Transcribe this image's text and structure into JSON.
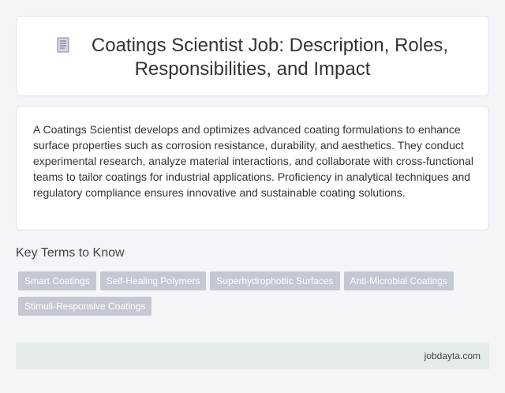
{
  "header": {
    "icon": "document-icon",
    "title": "Coatings Scientist Job: Description, Roles, Responsibilities, and Impact"
  },
  "description": "A Coatings Scientist develops and optimizes advanced coating formulations to enhance surface properties such as corrosion resistance, durability, and aesthetics. They conduct experimental research, analyze material interactions, and collaborate with cross-functional teams to tailor coatings for industrial applications. Proficiency in analytical techniques and regulatory compliance ensures innovative and sustainable coating solutions.",
  "key_terms": {
    "heading": "Key Terms to Know",
    "tags": [
      "Smart Coatings",
      "Self-Healing Polymers",
      "Superhydrophobic Surfaces",
      "Anti-Microbial Coatings",
      "Stimuli-Responsive Coatings"
    ]
  },
  "footer": {
    "site": "jobdayta.com"
  },
  "colors": {
    "tag_background": "#c4c8d2",
    "footer_background": "#e6ebee",
    "page_background": "#f4f5f9"
  }
}
